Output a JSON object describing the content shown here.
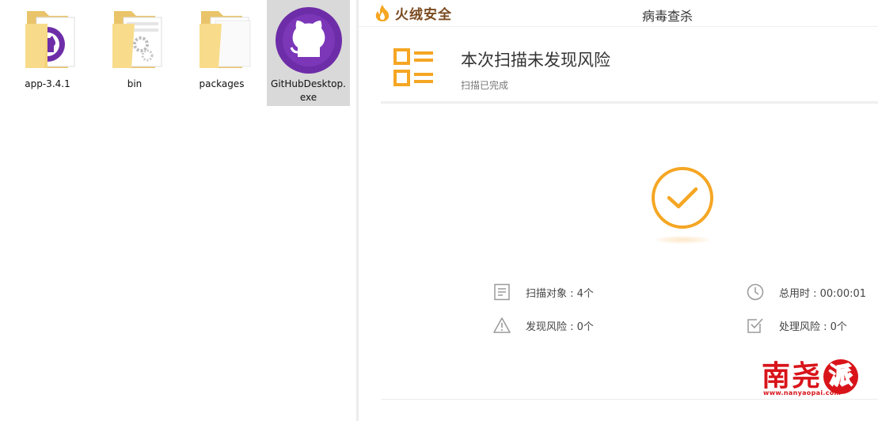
{
  "explorer": {
    "items": [
      {
        "name": "app-3.4.1",
        "icon": "github-folder-icon"
      },
      {
        "name": "bin",
        "icon": "gear-folder-icon"
      },
      {
        "name": "packages",
        "icon": "folder-icon"
      },
      {
        "name_line1": "GitHubDesktop.",
        "name_line2": "exe",
        "icon": "github-app-icon",
        "selected": true
      }
    ]
  },
  "antivirus": {
    "brand": "火绒安全",
    "window_title": "病毒查杀",
    "result_title": "本次扫描未发现风险",
    "result_subtitle": "扫描已完成",
    "stats": {
      "scanned_objects": "扫描对象 : 4个",
      "elapsed_time": "总用时 : 00:00:01",
      "risks_found": "发现风险 : 0个",
      "risks_handled": "处理风险 : 0个"
    },
    "colors": {
      "accent": "#f5a623",
      "brand_text": "#7a4a1f",
      "icon_gray": "#9a9a9a"
    }
  },
  "watermark": {
    "chars": [
      "南",
      "尧",
      "派"
    ],
    "url": "www.nanyaopai.com"
  }
}
